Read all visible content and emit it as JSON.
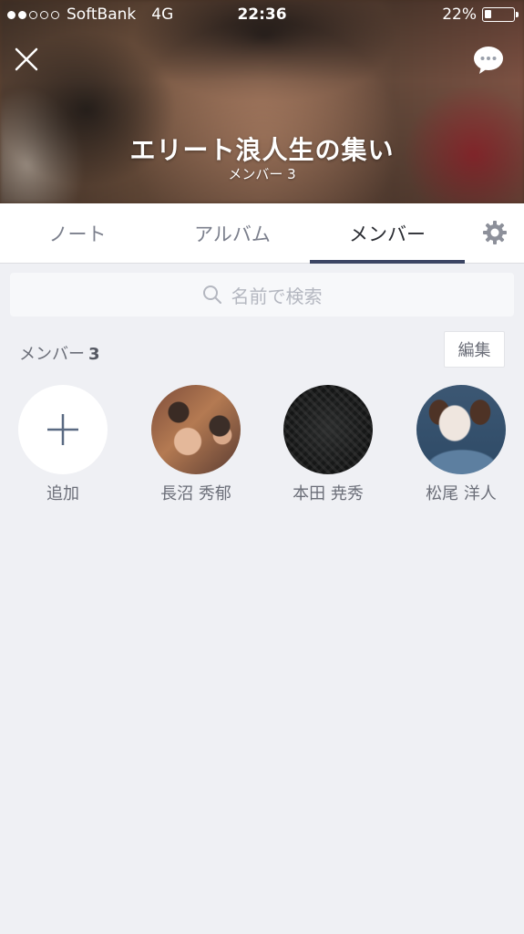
{
  "status_bar": {
    "signal_dots": [
      true,
      true,
      false,
      false,
      false
    ],
    "carrier": "SoftBank",
    "network": "4G",
    "time": "22:36",
    "battery_text": "22%",
    "battery_level": 0.22
  },
  "header": {
    "close_icon": "close-icon",
    "chat_icon": "chat-bubble-icon",
    "group_name": "エリート浪人生の集い",
    "member_count_label": "メンバー 3"
  },
  "tabs": [
    {
      "label": "ノート",
      "active": false
    },
    {
      "label": "アルバム",
      "active": false
    },
    {
      "label": "メンバー",
      "active": true
    }
  ],
  "settings_icon": "gear-icon",
  "search": {
    "placeholder": "名前で検索"
  },
  "members_section": {
    "label": "メンバー",
    "count": "3",
    "edit_label": "編集"
  },
  "members": [
    {
      "name": "追加",
      "kind": "add"
    },
    {
      "name": "長沼 秀郁",
      "kind": "photo"
    },
    {
      "name": "本田 尭秀",
      "kind": "photo"
    },
    {
      "name": "松尾 洋人",
      "kind": "photo"
    }
  ],
  "colors": {
    "tab_indicator": "#3b4563",
    "background": "#eff0f4"
  }
}
